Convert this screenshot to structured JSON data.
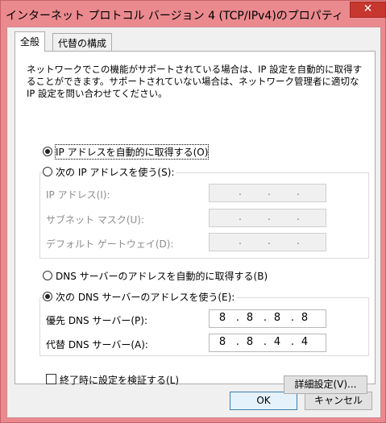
{
  "window": {
    "title": "インターネット プロトコル バージョン 4 (TCP/IPv4)のプロパティ",
    "close_glyph": "✕"
  },
  "tabs": [
    {
      "label": "全般",
      "active": true
    },
    {
      "label": "代替の構成",
      "active": false
    }
  ],
  "general": {
    "description": "ネットワークでこの機能がサポートされている場合は、IP 設定を自動的に取得することができます。サポートされていない場合は、ネットワーク管理者に適切な IP 設定を問い合わせてください。",
    "ip_auto_label": "IP アドレスを自動的に取得する(O)",
    "ip_manual_label": "次の IP アドレスを使う(S):",
    "ip_address_label": "IP アドレス(I):",
    "subnet_label": "サブネット マスク(U):",
    "gateway_label": "デフォルト ゲートウェイ(D):",
    "dns_auto_label": "DNS サーバーのアドレスを自動的に取得する(B)",
    "dns_manual_label": "次の DNS サーバーのアドレスを使う(E):",
    "preferred_dns_label": "優先 DNS サーバー(P):",
    "preferred_dns": [
      "8",
      "8",
      "8",
      "8"
    ],
    "alternate_dns_label": "代替 DNS サーバー(A):",
    "alternate_dns": [
      "8",
      "8",
      "4",
      "4"
    ],
    "ip_dot": ".",
    "validate_label": "終了時に設定を検証する(L)",
    "advanced_button": "詳細設定(V)..."
  },
  "footer": {
    "ok_button": "OK",
    "cancel_button": "キャンセル"
  },
  "colors": {
    "frame": "#ea8a8f",
    "close": "#c7362f",
    "panel": "#ffffff",
    "client": "#f0f0f0"
  }
}
